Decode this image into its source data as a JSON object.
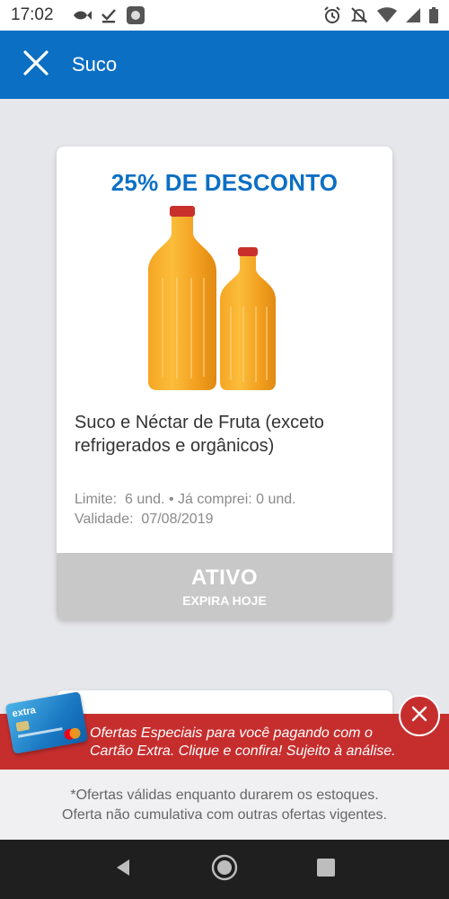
{
  "status_bar": {
    "time": "17:02",
    "icons": [
      "fish-icon",
      "download-done-icon",
      "app-icon",
      "alarm-icon",
      "notifications-off-icon",
      "wifi-icon",
      "signal-icon",
      "battery-icon"
    ]
  },
  "app_bar": {
    "title": "Suco",
    "close_icon": "close-icon",
    "color": "#0b6fc4"
  },
  "offer": {
    "discount": "25% DE DESCONTO",
    "image": "juice-bottles",
    "description": "Suco e Néctar de Fruta (exceto refrigerados e orgânicos)",
    "limit_line": "Limite:  6 und. • Já comprei: 0 und.",
    "validity_line": "Validade:  07/08/2019",
    "status": "ATIVO",
    "expiry": "EXPIRA HOJE"
  },
  "promo_banner": {
    "text": "Ofertas Especiais para você pagando com o Cartão Extra. Clique e confira! Sujeito à análise.",
    "card_brand": "extra",
    "close_icon": "close-icon",
    "color": "#c62e2e"
  },
  "footer": {
    "line1": "*Ofertas válidas enquanto durarem os estoques.",
    "line2": "Oferta não cumulativa com outras ofertas vigentes."
  },
  "nav_bar": {
    "buttons": [
      "back-icon",
      "home-icon",
      "recents-icon"
    ]
  }
}
